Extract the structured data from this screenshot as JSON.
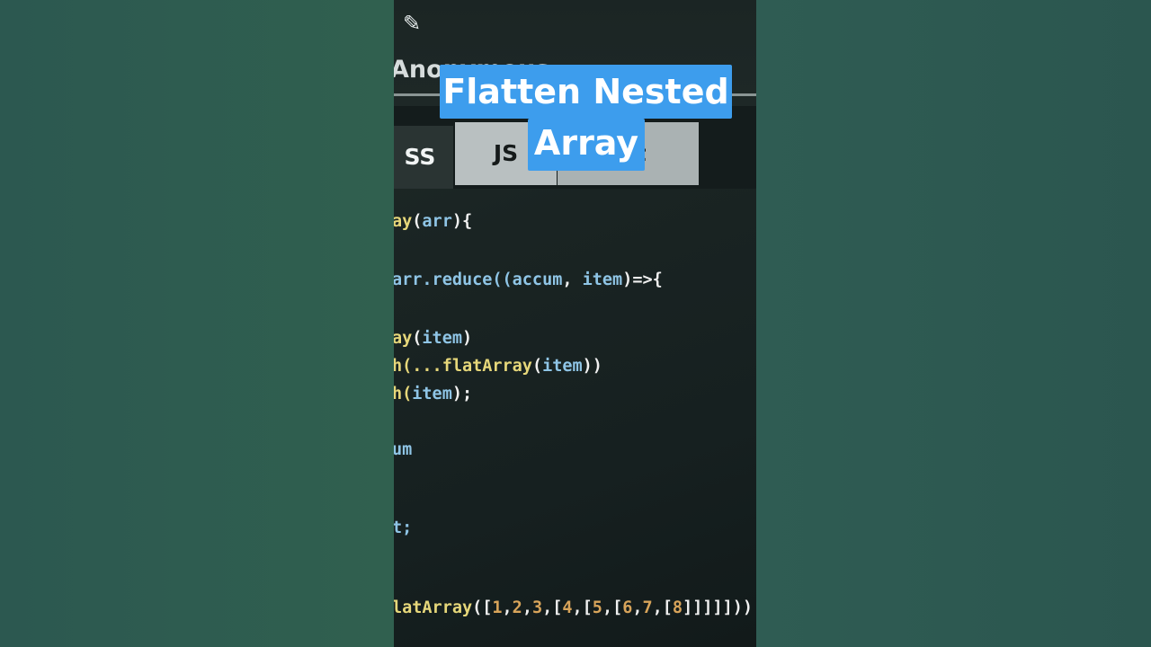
{
  "caption": {
    "line1": "Flatten Nested",
    "line2": "Array"
  },
  "header": {
    "user_name": "Anonymous"
  },
  "tabs": [
    {
      "label": "SS"
    },
    {
      "label": "JS"
    },
    {
      "label": "lt"
    }
  ],
  "code": {
    "l1a": "ay",
    "l1b": "(",
    "l1c": "arr",
    "l1d": "){",
    "l2a": "arr.reduce((",
    "l2b": "accum",
    "l2c": ", ",
    "l2d": "item",
    "l2e": ")=>{",
    "l3a": "ay",
    "l3b": "(",
    "l3c": "item",
    "l3d": ")",
    "l4a": "h(...",
    "l4b": "flatArray",
    "l4c": "(",
    "l4d": "item",
    "l4e": "))",
    "l5a": "h(",
    "l5b": "item",
    "l5c": ");",
    "l6a": "um",
    "l7a": "t;",
    "l8a": "latArray",
    "l8b": "([",
    "l8n1": "1",
    "l8n2": "2",
    "l8n3": "3",
    "l8n4": "4",
    "l8n5": "5",
    "l8n6": "6",
    "l8n7": "7",
    "l8n8": "8",
    "l8end": "]]]]]))"
  },
  "colors": {
    "caption_bg": "#3d9ded",
    "function_name": "#e6d77a",
    "variable": "#8fc5e6",
    "number": "#d8a45a"
  },
  "icons": {
    "edit": "pencil-icon"
  }
}
